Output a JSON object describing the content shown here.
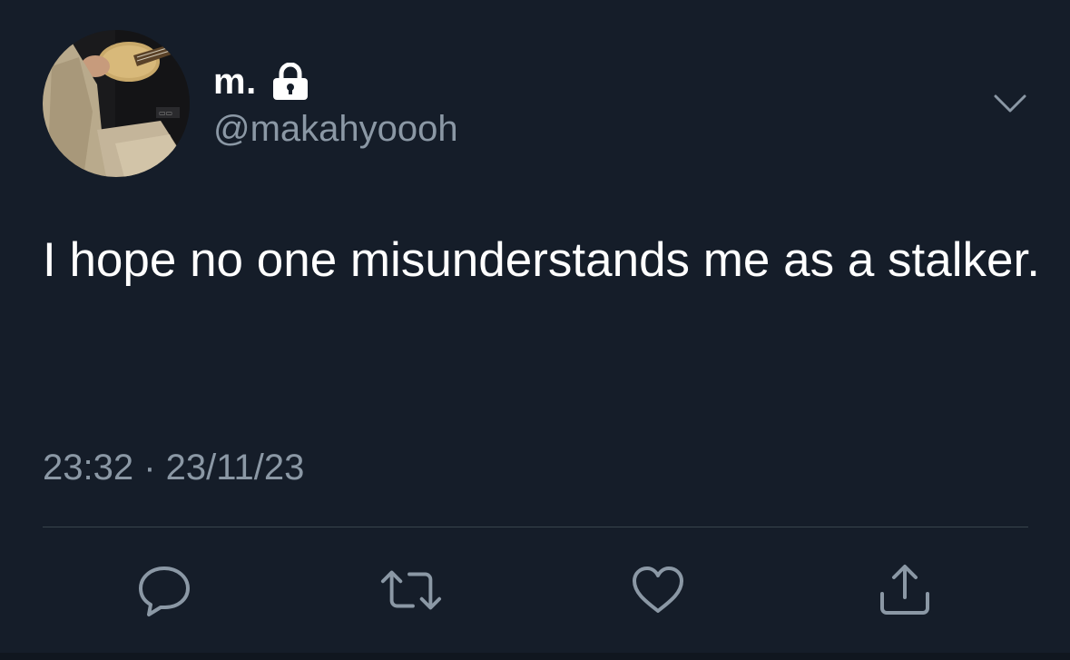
{
  "theme": {
    "background": "#151d29",
    "primary_text": "#ffffff",
    "secondary_text": "#8b98a5",
    "icon_color": "#8b98a5",
    "divider": "#38444d"
  },
  "tweet": {
    "author": {
      "display_name": "m.",
      "handle": "@makahyoooh",
      "protected": true,
      "verified_icon": "lock-icon"
    },
    "text": "I hope no one misunderstands me as a stalker.",
    "timestamp": "23:32 · 23/11/23"
  },
  "actions": [
    {
      "name": "reply",
      "icon": "reply-icon"
    },
    {
      "name": "retweet",
      "icon": "retweet-icon"
    },
    {
      "name": "like",
      "icon": "heart-icon"
    },
    {
      "name": "share",
      "icon": "share-icon"
    }
  ],
  "menu": {
    "icon": "chevron-down-icon"
  }
}
